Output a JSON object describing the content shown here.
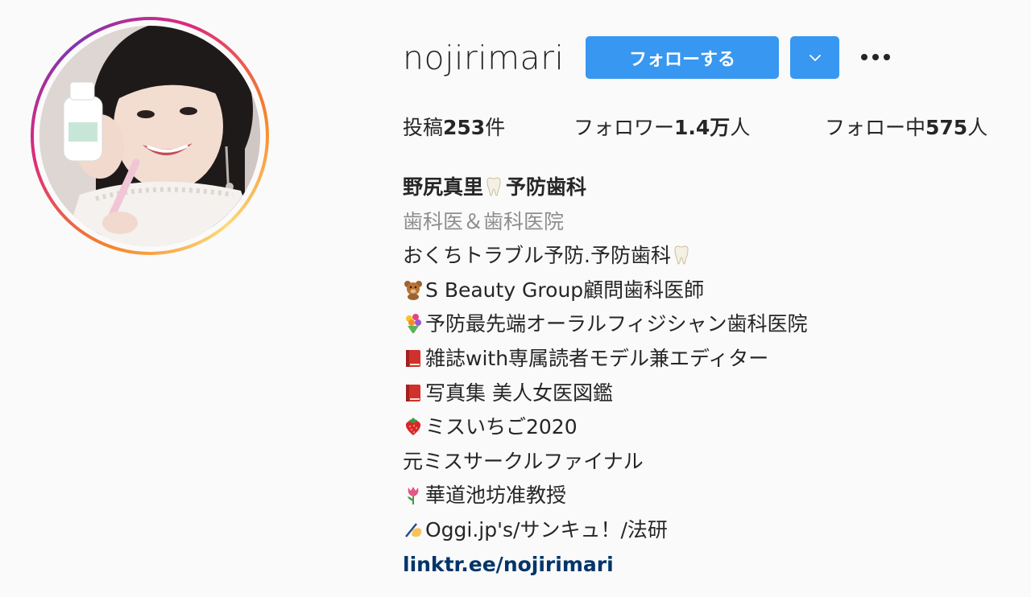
{
  "profile": {
    "username": "nojirimari",
    "follow_label": "フォローする",
    "dropdown_icon": "chevron-down-icon",
    "more_icon": "more-options-icon",
    "accent_color": "#3897f0"
  },
  "stats": {
    "posts_label": "投稿",
    "posts_count": "253",
    "posts_suffix": "件",
    "followers_label": "フォロワー",
    "followers_count": "1.4万",
    "followers_suffix": "人",
    "following_label": "フォロー中",
    "following_count": "575",
    "following_suffix": "人"
  },
  "bio": {
    "name": "野尻真里",
    "name_suffix": "予防歯科",
    "category": "歯科医＆歯科医院",
    "lines": [
      "おくちトラブル予防.予防歯科",
      "S Beauty Group顧問歯科医師",
      "予防最先端オーラルフィジシャン歯科医院",
      "雑誌with専属読者モデル兼エディター",
      "写真集 美人女医図鑑",
      "ミスいちご2020",
      "元ミスサークルファイナル",
      "華道池坊准教授",
      "Oggi.jp's/サンキュ！/法研"
    ],
    "emoji_icons": [
      "tooth-emoji",
      "teddy-bear-emoji",
      "bouquet-emoji",
      "red-book-emoji",
      "red-book-emoji",
      "strawberry-emoji",
      "tulip-emoji",
      "writing-hand-emoji"
    ],
    "link": "linktr.ee/nojirimari"
  }
}
